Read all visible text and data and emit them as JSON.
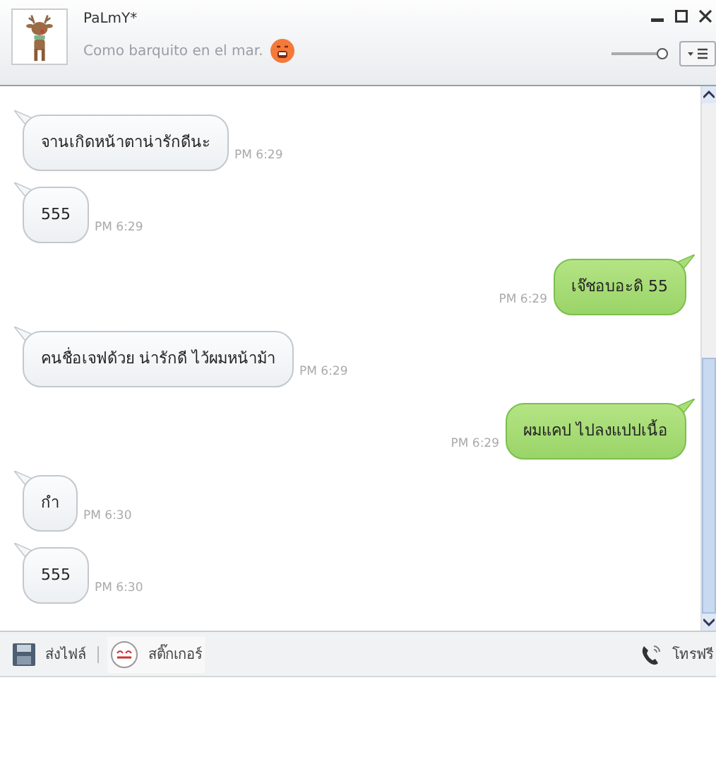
{
  "contact": {
    "name": "PaLmY*",
    "status": "Como barquito en el mar."
  },
  "volume": {
    "level": 1
  },
  "messages": [
    {
      "kind": "incoming",
      "text": "จานเกิดหน้าตาน่ารักดีนะ",
      "time": "PM 6:29"
    },
    {
      "kind": "incoming",
      "text": "555",
      "time": "PM 6:29"
    },
    {
      "kind": "outgoing",
      "text": "เจ๊ชอบอะดิ 55",
      "time": "PM 6:29"
    },
    {
      "kind": "incoming",
      "text": "คนชื่อเจฟด้วย น่ารักดี ไว้ผมหน้าม้า",
      "time": "PM 6:29"
    },
    {
      "kind": "outgoing",
      "text": "ผมแคป ไปลงแปปเนื้อ",
      "time": "PM 6:29"
    },
    {
      "kind": "incoming",
      "text": "กำ",
      "time": "PM 6:30"
    },
    {
      "kind": "incoming",
      "text": "555",
      "time": "PM 6:30"
    }
  ],
  "toolbar": {
    "send_file": "ส่งไฟล์",
    "sticker": "สติ๊กเกอร์",
    "call": "โทรฟรี"
  }
}
